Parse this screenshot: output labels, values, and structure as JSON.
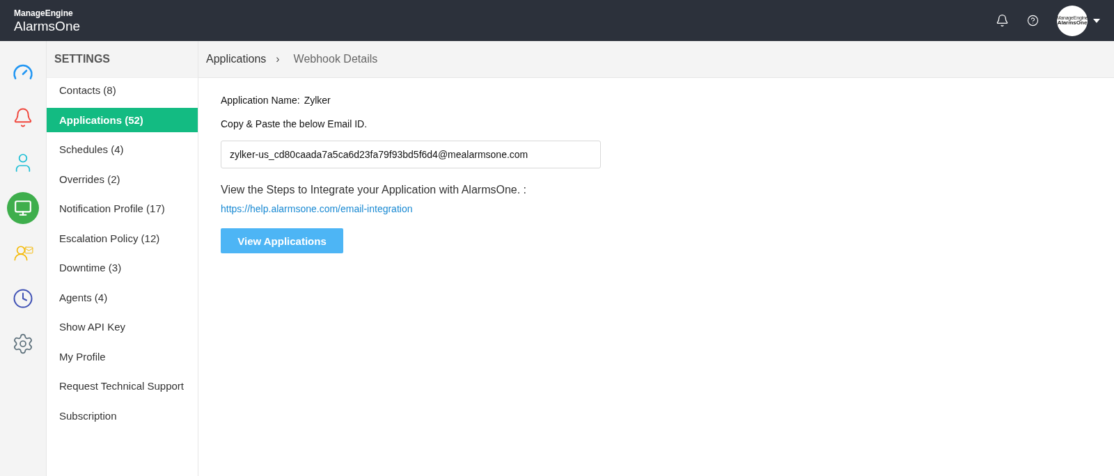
{
  "header": {
    "brand_top": "ManageEngine",
    "brand_name": "AlarmsOne",
    "avatar_top": "ManageEngine",
    "avatar_name": "AlarmsOne"
  },
  "rail": [
    {
      "kind": "dashboard",
      "selected": false
    },
    {
      "kind": "alarms",
      "selected": false
    },
    {
      "kind": "users",
      "selected": false
    },
    {
      "kind": "applications",
      "selected": true
    },
    {
      "kind": "oncall",
      "selected": false
    },
    {
      "kind": "history",
      "selected": false
    },
    {
      "kind": "settings",
      "selected": false
    }
  ],
  "sidebar": {
    "title": "SETTINGS",
    "items": [
      {
        "label": "Contacts (8)",
        "selected": false
      },
      {
        "label": "Applications (52)",
        "selected": true
      },
      {
        "label": "Schedules (4)",
        "selected": false
      },
      {
        "label": "Overrides (2)",
        "selected": false
      },
      {
        "label": "Notification Profile (17)",
        "selected": false
      },
      {
        "label": "Escalation Policy (12)",
        "selected": false
      },
      {
        "label": "Downtime (3)",
        "selected": false
      },
      {
        "label": "Agents (4)",
        "selected": false
      },
      {
        "label": "Show API Key",
        "selected": false
      },
      {
        "label": "My Profile",
        "selected": false
      },
      {
        "label": "Request Technical Support",
        "selected": false
      },
      {
        "label": "Subscription",
        "selected": false
      }
    ]
  },
  "breadcrumb": {
    "parent": "Applications",
    "separator": "›",
    "current": "Webhook Details"
  },
  "details": {
    "name_label": "Application Name:",
    "name_value": "Zylker",
    "copy_label": "Copy & Paste the below Email ID.",
    "email": "zylker-us_cd80caada7a5ca6d23fa79f93bd5f6d4@mealarmsone.com",
    "steps_text": "View the Steps to Integrate your Application with AlarmsOne. :",
    "help_link": "https://help.alarmsone.com/email-integration",
    "button": "View Applications"
  }
}
